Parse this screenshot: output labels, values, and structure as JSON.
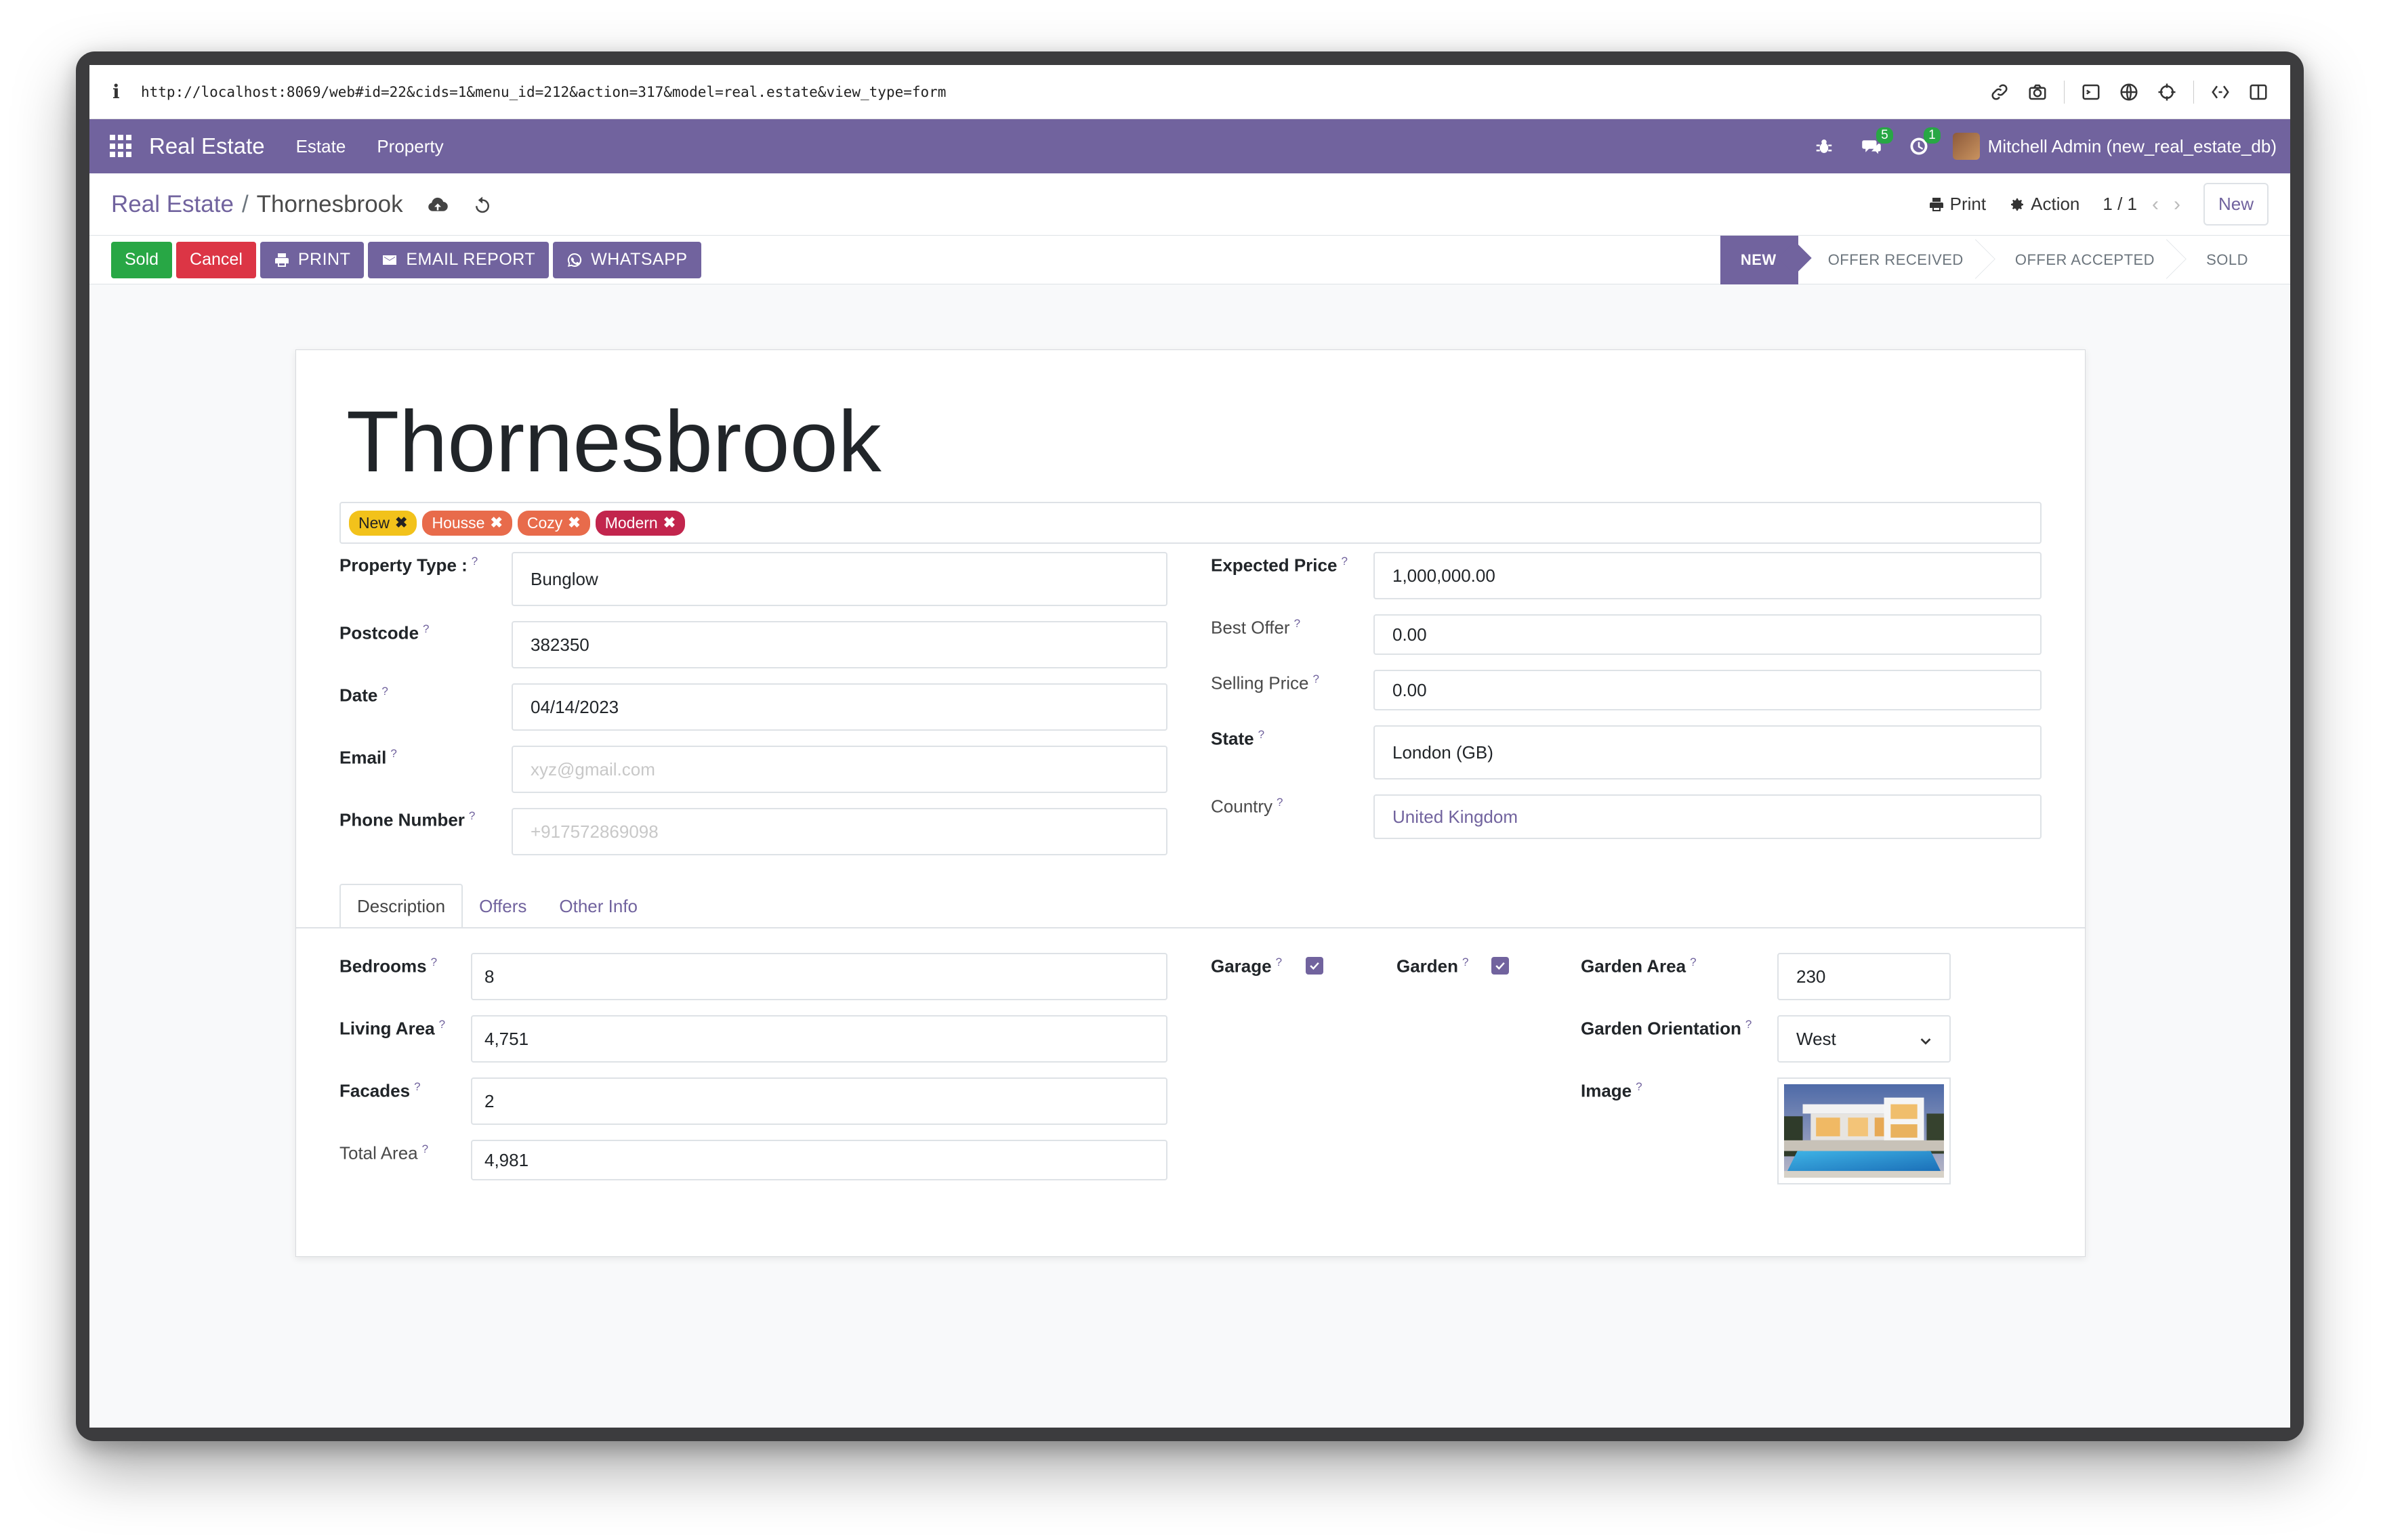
{
  "browser": {
    "info_glyph": "i",
    "url": "http://localhost:8069/web#id=22&cids=1&menu_id=212&action=317&model=real.estate&view_type=form"
  },
  "nav": {
    "brand": "Real Estate",
    "menus": [
      "Estate",
      "Property"
    ],
    "messages_count": "5",
    "activities_count": "1",
    "user": "Mitchell Admin (new_real_estate_db)"
  },
  "control": {
    "breadcrumb_root": "Real Estate",
    "breadcrumb_sep": "/",
    "breadcrumb_current": "Thornesbrook",
    "print": "Print",
    "action": "Action",
    "pager": "1 / 1",
    "new": "New"
  },
  "statusbar": {
    "sold": "Sold",
    "cancel": "Cancel",
    "print": "PRINT",
    "email_report": "EMAIL REPORT",
    "whatsapp": "WHATSAPP",
    "stages": [
      "NEW",
      "OFFER RECEIVED",
      "OFFER ACCEPTED",
      "SOLD"
    ],
    "active_stage": "NEW"
  },
  "form": {
    "name": "Thornesbrook",
    "tags": [
      {
        "label": "New",
        "color": "#f2c21b"
      },
      {
        "label": "Housse",
        "color": "#e86b4b"
      },
      {
        "label": "Cozy",
        "color": "#e86b4b"
      },
      {
        "label": "Modern",
        "color": "#c2254d"
      }
    ],
    "property_type_label": "Property Type :",
    "property_type": "Bunglow",
    "postcode_label": "Postcode",
    "postcode": "382350",
    "date_label": "Date",
    "date": "04/14/2023",
    "email_label": "Email",
    "email_placeholder": "xyz@gmail.com",
    "phone_label": "Phone Number",
    "phone_placeholder": "+917572869098",
    "expected_price_label": "Expected Price",
    "expected_price": "1,000,000.00",
    "best_offer_label": "Best Offer",
    "best_offer": "0.00",
    "selling_price_label": "Selling Price",
    "selling_price": "0.00",
    "state_label": "State",
    "state": "London (GB)",
    "country_label": "Country",
    "country": "United Kingdom",
    "help_mark": "?"
  },
  "tabs": [
    "Description",
    "Offers",
    "Other Info"
  ],
  "description": {
    "bedrooms_label": "Bedrooms",
    "bedrooms": "8",
    "living_area_label": "Living Area",
    "living_area": "4,751",
    "facades_label": "Facades",
    "facades": "2",
    "total_area_label": "Total Area",
    "total_area": "4,981",
    "garage_label": "Garage",
    "garage": true,
    "garden_label": "Garden",
    "garden": true,
    "garden_area_label": "Garden Area",
    "garden_area": "230",
    "garden_orientation_label": "Garden Orientation",
    "garden_orientation": "West",
    "image_label": "Image"
  },
  "colors": {
    "brand": "#71639e",
    "success": "#28a745",
    "danger": "#dc3545"
  }
}
